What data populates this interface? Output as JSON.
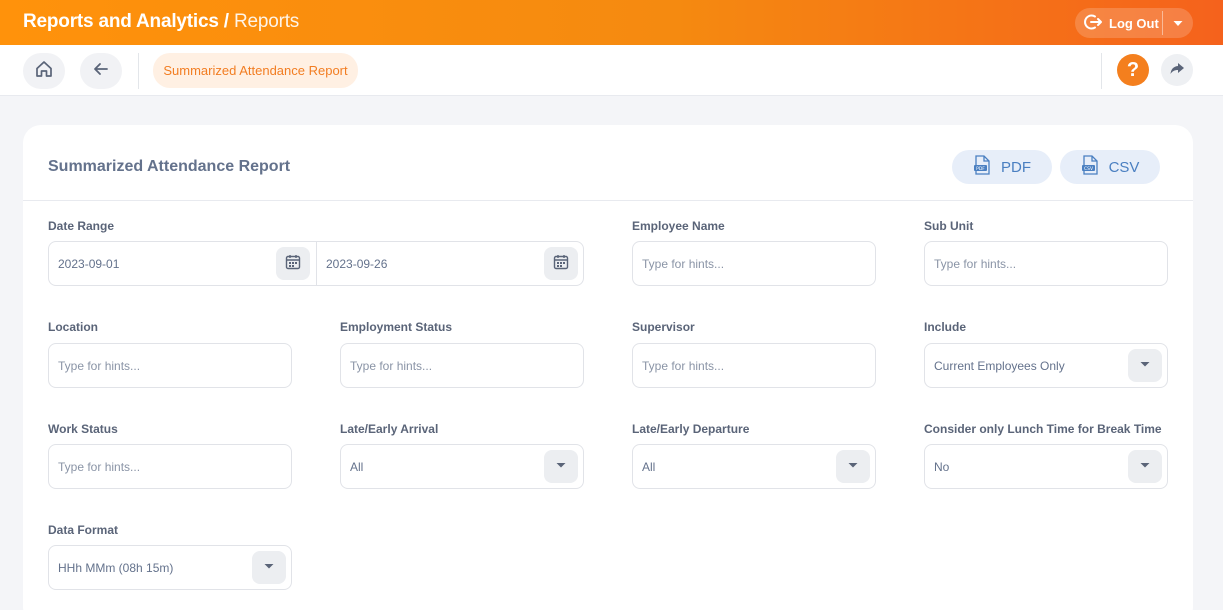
{
  "header": {
    "module": "Reports and Analytics",
    "separator": " / ",
    "section": "Reports",
    "logout_label": "Log Out"
  },
  "breadcrumb": {
    "label": "Summarized Attendance Report"
  },
  "help": {
    "label": "?"
  },
  "card": {
    "title": "Summarized Attendance Report",
    "pdf_label": "PDF",
    "csv_label": "CSV"
  },
  "filters": {
    "date_range": {
      "label": "Date Range",
      "from": "2023-09-01",
      "to": "2023-09-26"
    },
    "employee_name": {
      "label": "Employee Name",
      "placeholder": "Type for hints..."
    },
    "sub_unit": {
      "label": "Sub Unit",
      "placeholder": "Type for hints..."
    },
    "location": {
      "label": "Location",
      "placeholder": "Type for hints..."
    },
    "employment_status": {
      "label": "Employment Status",
      "placeholder": "Type for hints..."
    },
    "supervisor": {
      "label": "Supervisor",
      "placeholder": "Type for hints..."
    },
    "include": {
      "label": "Include",
      "value": "Current Employees Only"
    },
    "work_status": {
      "label": "Work Status",
      "placeholder": "Type for hints..."
    },
    "late_early_arrival": {
      "label": "Late/Early Arrival",
      "value": "All"
    },
    "late_early_departure": {
      "label": "Late/Early Departure",
      "value": "All"
    },
    "lunch_break": {
      "label": "Consider only Lunch Time for Break Time",
      "value": "No"
    },
    "data_format": {
      "label": "Data Format",
      "value": "HHh MMm (08h 15m)"
    }
  },
  "icons": [
    "logout-icon",
    "chevron-down-icon",
    "home-icon",
    "back-arrow-icon",
    "share-icon",
    "pdf-file-icon",
    "csv-file-icon",
    "calendar-icon"
  ],
  "colors": {
    "brand_orange": "#f58a10",
    "accent_blue": "#4a7fc1"
  }
}
